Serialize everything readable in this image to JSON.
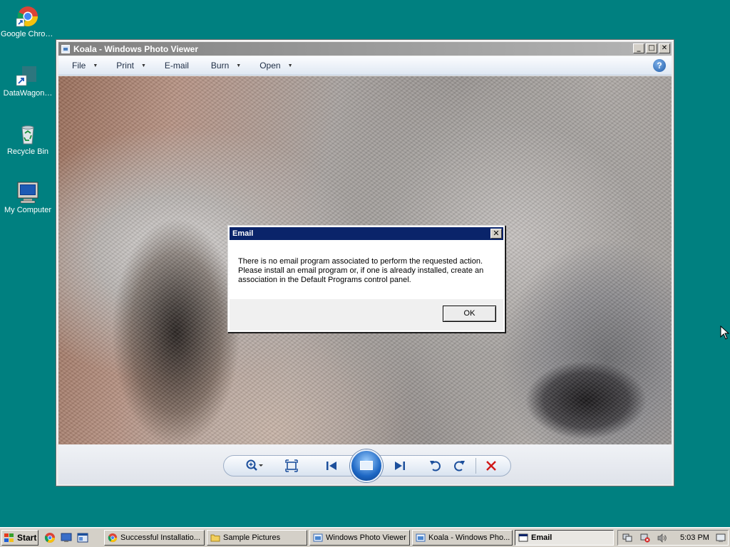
{
  "desktop": {
    "icons": [
      {
        "label": "Google Chrome",
        "icon": "chrome-icon"
      },
      {
        "label": "DataWagon…",
        "icon": "shortcut-icon"
      },
      {
        "label": "Recycle Bin",
        "icon": "recycle-bin-icon"
      },
      {
        "label": "My Computer",
        "icon": "my-computer-icon"
      }
    ]
  },
  "viewer": {
    "title": "Koala - Windows Photo Viewer",
    "window_buttons": {
      "minimize": "_",
      "maximize": "□",
      "close": "✕"
    },
    "menu": [
      {
        "label": "File",
        "dropdown": true
      },
      {
        "label": "Print",
        "dropdown": true
      },
      {
        "label": "E-mail",
        "dropdown": false
      },
      {
        "label": "Burn",
        "dropdown": true
      },
      {
        "label": "Open",
        "dropdown": true
      }
    ],
    "help_label": "?",
    "controls": {
      "zoom": "zoom-icon",
      "actual_size": "fit-window-icon",
      "previous": "previous-icon",
      "slideshow": "slideshow-icon",
      "next": "next-icon",
      "rotate_ccw": "rotate-counterclockwise-icon",
      "rotate_cw": "rotate-clockwise-icon",
      "delete": "delete-icon"
    }
  },
  "dialog": {
    "title": "Email",
    "message": "There is no email program associated to perform the requested action. Please install an email program or, if one is already installed, create an association in the Default Programs control panel.",
    "ok_label": "OK",
    "close_label": "✕"
  },
  "taskbar": {
    "start_label": "Start",
    "tasks": [
      {
        "label": "Successful Installatio...",
        "icon": "chrome-icon",
        "active": false
      },
      {
        "label": "Sample Pictures",
        "icon": "folder-icon",
        "active": false
      },
      {
        "label": "Windows Photo Viewer",
        "icon": "photo-viewer-icon",
        "active": false
      },
      {
        "label": "Koala - Windows Pho...",
        "icon": "photo-viewer-icon",
        "active": false
      },
      {
        "label": "Email",
        "icon": "dialog-icon",
        "active": true
      }
    ],
    "clock": "5:03 PM"
  },
  "colors": {
    "desktop": "#008080",
    "dialog_title": "#0a246a",
    "viewer_accent": "#1c4f9c",
    "delete": "#d01818"
  }
}
